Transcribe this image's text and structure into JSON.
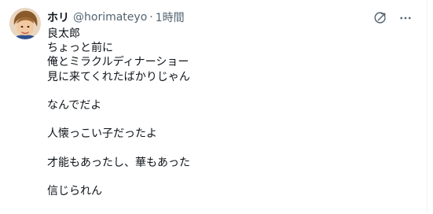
{
  "tweet": {
    "display_name": "ホリ",
    "handle": "@horimateyo",
    "separator": "·",
    "time": "1時間",
    "text_lines": [
      "良太郎",
      "ちょっと前に",
      "俺とミラクルディナーショー",
      "見に来てくれたばかりじゃん",
      "",
      "なんでだよ",
      "",
      "人懐っこい子だったよ",
      "",
      "才能もあったし、華もあった",
      "",
      "信じられん"
    ]
  },
  "icons": {
    "avatar": "profile-photo",
    "grok": "grok-icon",
    "more": "more-icon"
  },
  "colors": {
    "text_primary": "#0f1419",
    "text_secondary": "#536471",
    "icon": "#536471"
  }
}
